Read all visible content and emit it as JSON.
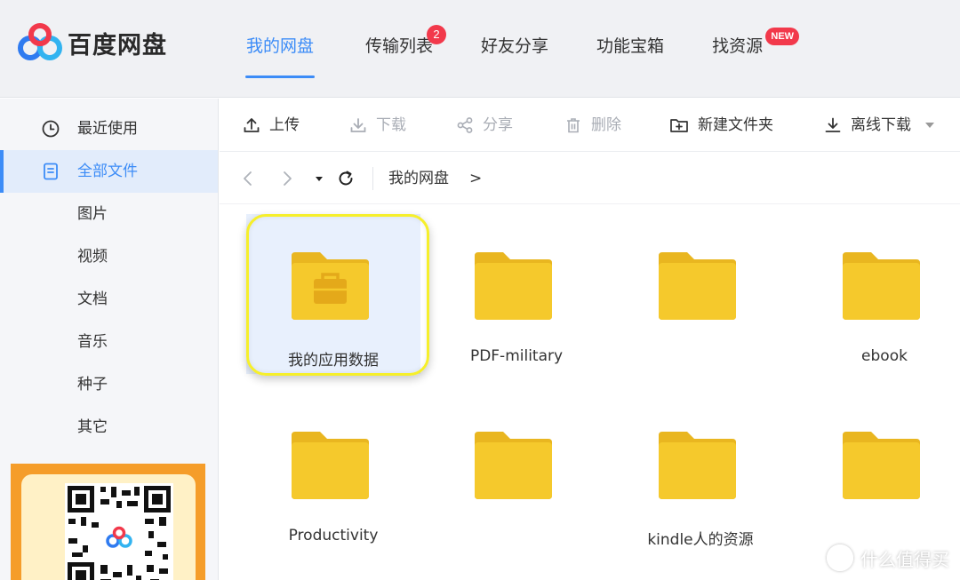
{
  "app": {
    "brand": "百度网盘",
    "brand_color": "#3c8cf7"
  },
  "nav": {
    "items": [
      {
        "label": "我的网盘",
        "active": true
      },
      {
        "label": "传输列表",
        "badge": "2"
      },
      {
        "label": "好友分享"
      },
      {
        "label": "功能宝箱"
      },
      {
        "label": "找资源",
        "badge": "NEW"
      }
    ]
  },
  "sidebar": {
    "recent": "最近使用",
    "all_files": "全部文件",
    "categories": [
      "图片",
      "视频",
      "文档",
      "音乐",
      "种子",
      "其它"
    ]
  },
  "toolbar": {
    "upload": "上传",
    "download": "下载",
    "share": "分享",
    "delete": "删除",
    "new_folder": "新建文件夹",
    "offline_download": "离线下载"
  },
  "breadcrumb": {
    "root": "我的网盘",
    "separator": ">"
  },
  "files": [
    {
      "name": "我的应用数据",
      "type": "app-folder",
      "selected": true
    },
    {
      "name": "PDF-military",
      "type": "folder"
    },
    {
      "name": "",
      "type": "folder"
    },
    {
      "name": "ebook",
      "type": "folder"
    },
    {
      "name": "Productivity",
      "type": "folder"
    },
    {
      "name": "",
      "type": "folder"
    },
    {
      "name": "kindle人的资源",
      "type": "folder"
    },
    {
      "name": "",
      "type": "folder"
    }
  ],
  "watermark": "什么值得买",
  "colors": {
    "folder": "#f5c92c",
    "folder_tab": "#e9b620",
    "highlight": "#f6ef2a",
    "badge": "#f2394b",
    "qr_border": "#f59d2a"
  }
}
